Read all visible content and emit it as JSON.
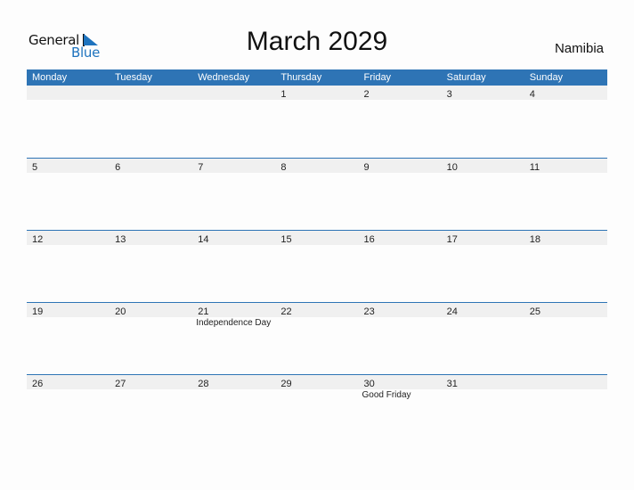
{
  "logo": {
    "general": "General",
    "blue": "Blue",
    "brand_color": "#1e73be"
  },
  "title": "March 2029",
  "country": "Namibia",
  "header_color": "#2e74b5",
  "days": [
    "Monday",
    "Tuesday",
    "Wednesday",
    "Thursday",
    "Friday",
    "Saturday",
    "Sunday"
  ],
  "weeks": [
    {
      "dates": [
        "",
        "",
        "",
        "1",
        "2",
        "3",
        "4"
      ],
      "events": [
        "",
        "",
        "",
        "",
        "",
        "",
        ""
      ]
    },
    {
      "dates": [
        "5",
        "6",
        "7",
        "8",
        "9",
        "10",
        "11"
      ],
      "events": [
        "",
        "",
        "",
        "",
        "",
        "",
        ""
      ]
    },
    {
      "dates": [
        "12",
        "13",
        "14",
        "15",
        "16",
        "17",
        "18"
      ],
      "events": [
        "",
        "",
        "",
        "",
        "",
        "",
        ""
      ]
    },
    {
      "dates": [
        "19",
        "20",
        "21",
        "22",
        "23",
        "24",
        "25"
      ],
      "events": [
        "",
        "",
        "Independence Day",
        "",
        "",
        "",
        ""
      ]
    },
    {
      "dates": [
        "26",
        "27",
        "28",
        "29",
        "30",
        "31",
        ""
      ],
      "events": [
        "",
        "",
        "",
        "",
        "Good Friday",
        "",
        ""
      ]
    }
  ]
}
